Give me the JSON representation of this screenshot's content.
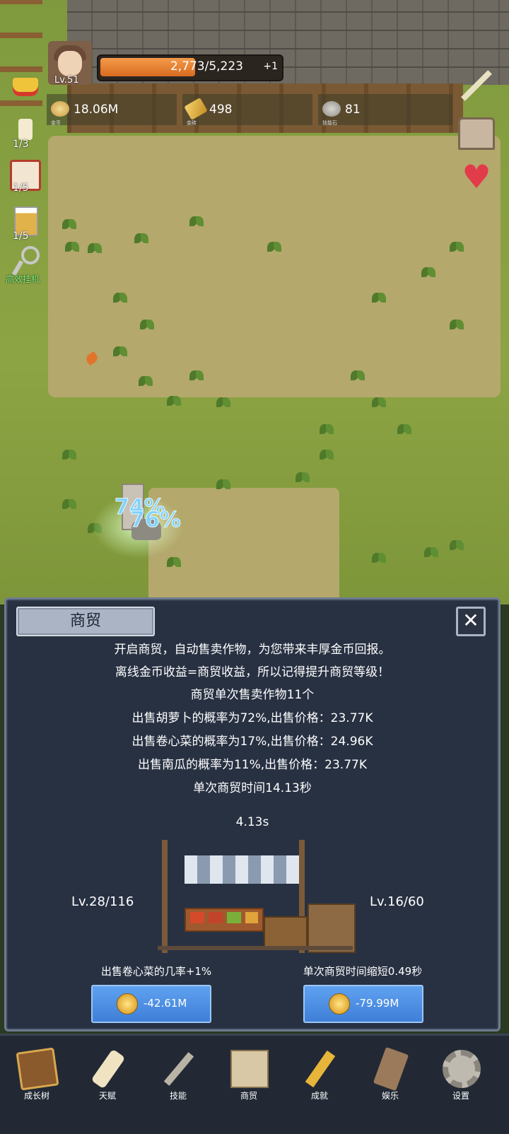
{
  "hud": {
    "level": "Lv.51",
    "xp_text": "2,773/5,223",
    "xp_fraction": 0.531,
    "xp_bonus": "+1",
    "resources": [
      {
        "name": "gold",
        "value": "18.06M",
        "caption": "金币"
      },
      {
        "name": "gold-bar",
        "value": "498",
        "caption": "金砖"
      },
      {
        "name": "skill-stone",
        "value": "81",
        "caption": "技能石"
      }
    ],
    "left_icons": [
      {
        "name": "crown",
        "count": ""
      },
      {
        "name": "candle",
        "count": "1/3"
      },
      {
        "name": "dice",
        "count": "1/5"
      },
      {
        "name": "beer",
        "count": "1/5"
      },
      {
        "name": "key",
        "count": "高效挂机"
      }
    ],
    "float_texts": [
      "74%",
      "76%"
    ]
  },
  "panel": {
    "title": "商贸",
    "close": "✕",
    "lines": [
      "开启商贸，自动售卖作物，为您带来丰厚金币回报。",
      "离线金币收益=商贸收益，所以记得提升商贸等级！",
      "商贸单次售卖作物11个",
      "出售胡萝卜的概率为72%,出售价格：23.77K",
      "出售卷心菜的概率为17%,出售价格：24.96K",
      "出售南瓜的概率为11%,出售价格：23.77K",
      "单次商贸时间14.13秒"
    ],
    "timer": "4.13s",
    "left_level": "Lv.28/116",
    "right_level": "Lv.16/60",
    "left_upgrade": {
      "caption": "出售卷心菜的几率+1%",
      "cost": "-42.61M"
    },
    "right_upgrade": {
      "caption": "单次商贸时间缩短0.49秒",
      "cost": "-79.99M"
    }
  },
  "nav": [
    {
      "name": "growth-tree",
      "label": "成长树"
    },
    {
      "name": "talent",
      "label": "天赋"
    },
    {
      "name": "skill",
      "label": "技能"
    },
    {
      "name": "trade",
      "label": "商贸"
    },
    {
      "name": "achievement",
      "label": "成就"
    },
    {
      "name": "entertainment",
      "label": "娱乐"
    },
    {
      "name": "settings",
      "label": "设置"
    }
  ]
}
